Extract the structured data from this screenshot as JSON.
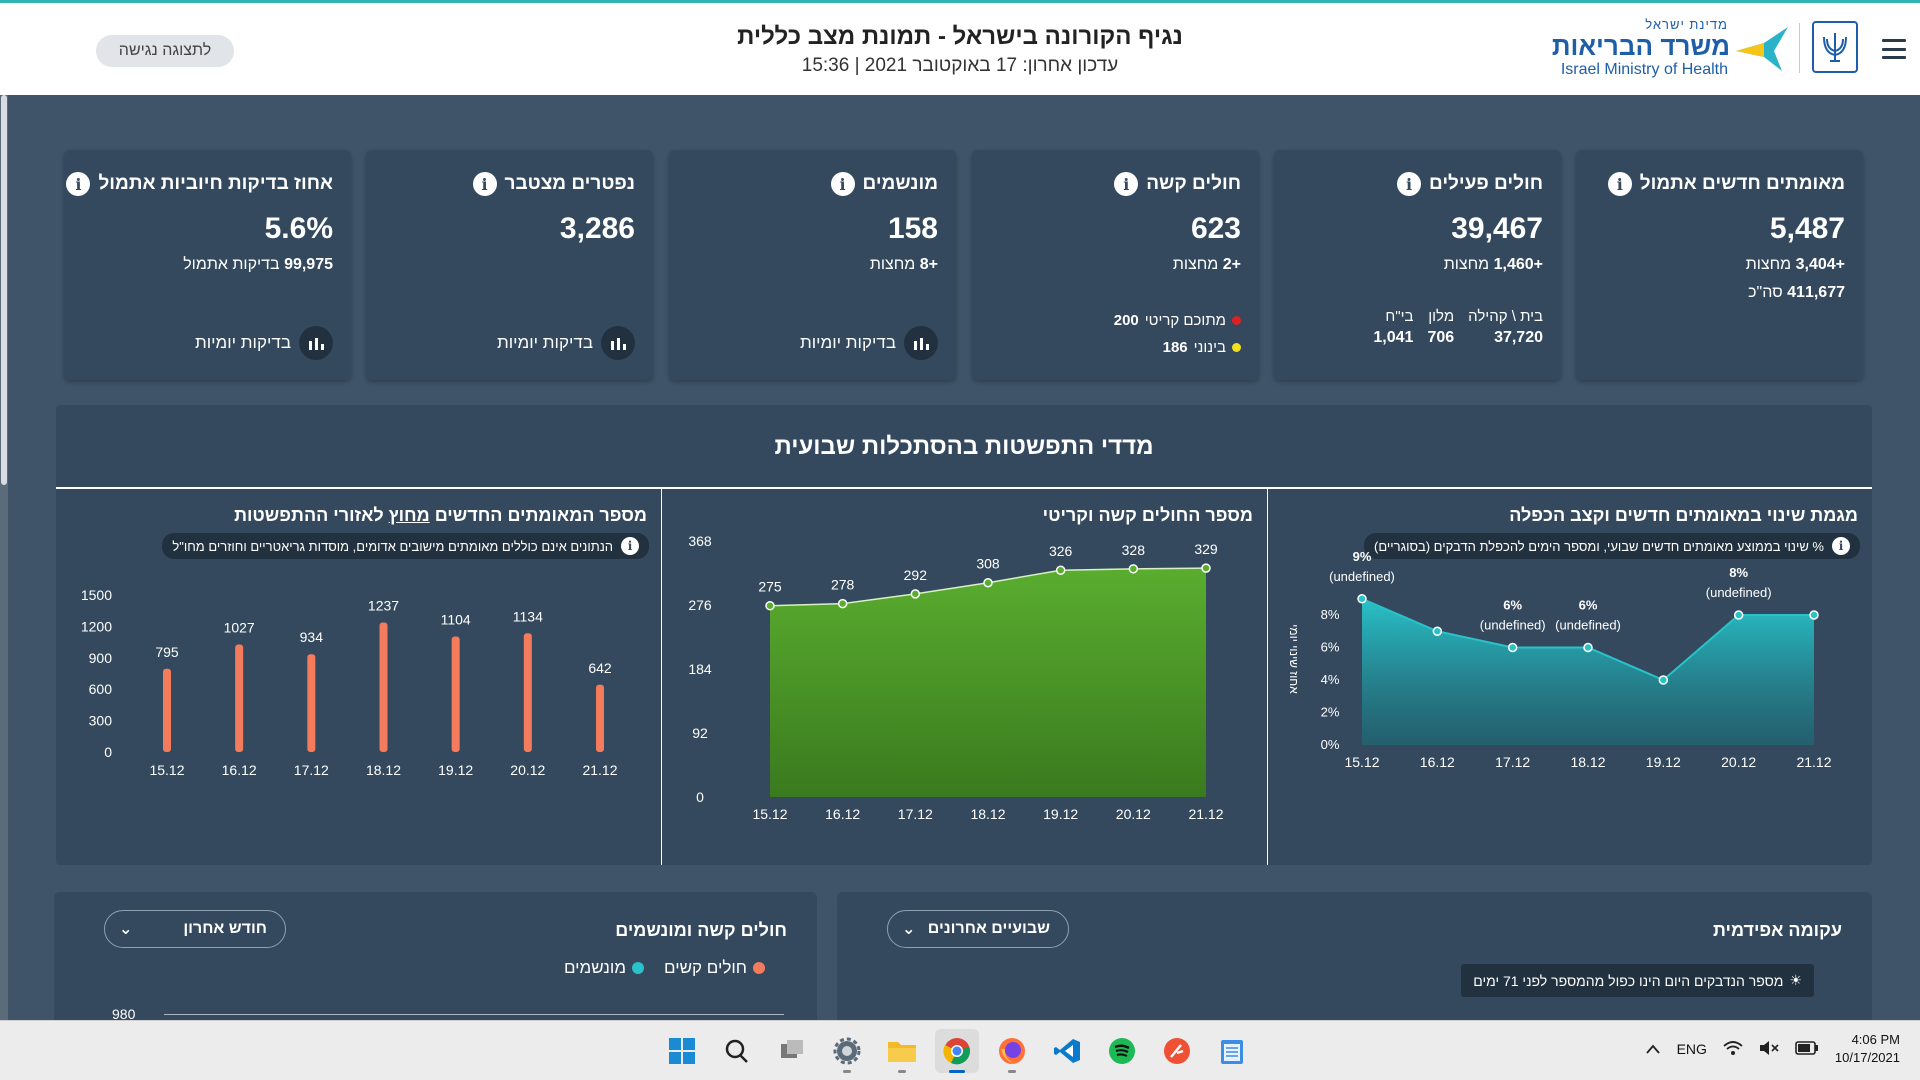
{
  "header": {
    "title": "נגיף הקורונה בישראל - תמונת מצב כללית",
    "updated": "עדכון אחרון: 17 באוקטובר 2021 | 15:36",
    "accessibility_button": "לתצוגה נגישה",
    "logo": {
      "small": "מדינת ישראל",
      "main": "משרד הבריאות",
      "english": "Israel Ministry of Health"
    }
  },
  "cards": [
    {
      "title": "מאומתים חדשים אתמול",
      "value": "5,487",
      "line1_num": "+3,404",
      "line1_label": "מחצות",
      "line2_num": "411,677",
      "line2_label": "סה\"כ"
    },
    {
      "title": "חולים פעילים",
      "value": "39,467",
      "line1_num": "+1,460",
      "line1_label": "מחצות",
      "breakdown": [
        {
          "label": "בית \\ קהילה",
          "num": "37,720"
        },
        {
          "label": "מלון",
          "num": "706"
        },
        {
          "label": "בי\"ח",
          "num": "1,041"
        }
      ]
    },
    {
      "title": "חולים קשה",
      "value": "623",
      "line1_num": "+2",
      "line1_label": "מחצות",
      "critical_num": "200",
      "critical_label": "מתוכם קריטי",
      "mid_num": "186",
      "mid_label": "בינוני"
    },
    {
      "title": "מונשמים",
      "value": "158",
      "line1_num": "+8",
      "line1_label": "מחצות",
      "link": "בדיקות יומיות"
    },
    {
      "title": "נפטרים מצטבר",
      "value": "3,286",
      "link": "בדיקות יומיות"
    },
    {
      "title": "אחוז בדיקות חיוביות אתמול",
      "value": "5.6%",
      "line1_num": "99,975",
      "line1_label": "בדיקות אתמול",
      "link": "בדיקות יומיות"
    }
  ],
  "weekly": {
    "title": "מדדי התפשטות בהסתכלות שבועית",
    "panel_trend": {
      "title": "מגמת שינוי במאומתים חדשים וקצב הכפלה",
      "note": "% שינוי בממוצע מאומתים חדשים שבועי, ומספר הימים להכפלת הדבקים (בסוגריים)"
    },
    "panel_severe": {
      "title": "מספר החולים קשה וקריטי"
    },
    "panel_outside": {
      "title_pre": "מספר המאומתים החדשים ",
      "title_u": "מחוץ",
      "title_post": " לאזורי ההתפשטות",
      "note": "הנתונים אינם כוללים מאומתים מישובים אדומים, מוסדות גריאטריים וחוזרים מחו\"ל"
    }
  },
  "chart_data": [
    {
      "type": "area",
      "title": "מגמת שינוי במאומתים חדשים וקצב הכפלה",
      "ylabel": "אחוז שינוי יומי",
      "x": [
        "15.12",
        "16.12",
        "17.12",
        "18.12",
        "19.12",
        "20.12",
        "21.12"
      ],
      "values": [
        9,
        7,
        6,
        6,
        4,
        8,
        8
      ],
      "ylim": [
        0,
        8
      ],
      "yticks": [
        "0%",
        "2%",
        "4%",
        "6%",
        "8%"
      ],
      "labels": [
        {
          "i": 0,
          "pct": "9%",
          "doubling": "(undefined)"
        },
        {
          "i": 2,
          "pct": "6%",
          "doubling": "(undefined)"
        },
        {
          "i": 3,
          "pct": "6%",
          "doubling": "(undefined)"
        },
        {
          "i": 5,
          "pct": "8%",
          "doubling": "(undefined)"
        }
      ],
      "color": "#29c2c9"
    },
    {
      "type": "area",
      "title": "מספר החולים קשה וקריטי",
      "x": [
        "15.12",
        "16.12",
        "17.12",
        "18.12",
        "19.12",
        "20.12",
        "21.12"
      ],
      "values": [
        275,
        278,
        292,
        308,
        326,
        328,
        329
      ],
      "ylim": [
        0,
        368
      ],
      "yticks": [
        "0",
        "92",
        "184",
        "276",
        "368"
      ],
      "color": "#5aad2f"
    },
    {
      "type": "bar",
      "title": "מספר המאומתים החדשים מחוץ לאזורי ההתפשטות",
      "categories": [
        "15.12",
        "16.12",
        "17.12",
        "18.12",
        "19.12",
        "20.12",
        "21.12"
      ],
      "values": [
        795,
        1027,
        934,
        1237,
        1104,
        1134,
        642
      ],
      "ylim": [
        0,
        1500
      ],
      "yticks": [
        "0",
        "300",
        "600",
        "900",
        "1200",
        "1500"
      ],
      "color": "#f47c5c"
    }
  ],
  "bottom": {
    "left_title": "עקומה אפידמית",
    "left_select": "שבועיים אחרונים",
    "left_tip": "מספר הנדבקים היום הינו כפול מהמספר לפני 71 ימים",
    "right_title": "חולים קשה ומונשמים",
    "right_select": "חודש אחרון",
    "legend": [
      {
        "label": "חולים קשים",
        "color": "#f47c5c"
      },
      {
        "label": "מונשמים",
        "color": "#29c2c9"
      }
    ],
    "yaxis_top": "980"
  },
  "taskbar": {
    "lang": "ENG",
    "time": "4:06 PM",
    "date": "10/17/2021",
    "apps": [
      "windows-start",
      "search",
      "task-view",
      "settings",
      "file-explorer",
      "chrome",
      "firefox",
      "vscode",
      "spotify",
      "git-tool",
      "notepad"
    ]
  }
}
